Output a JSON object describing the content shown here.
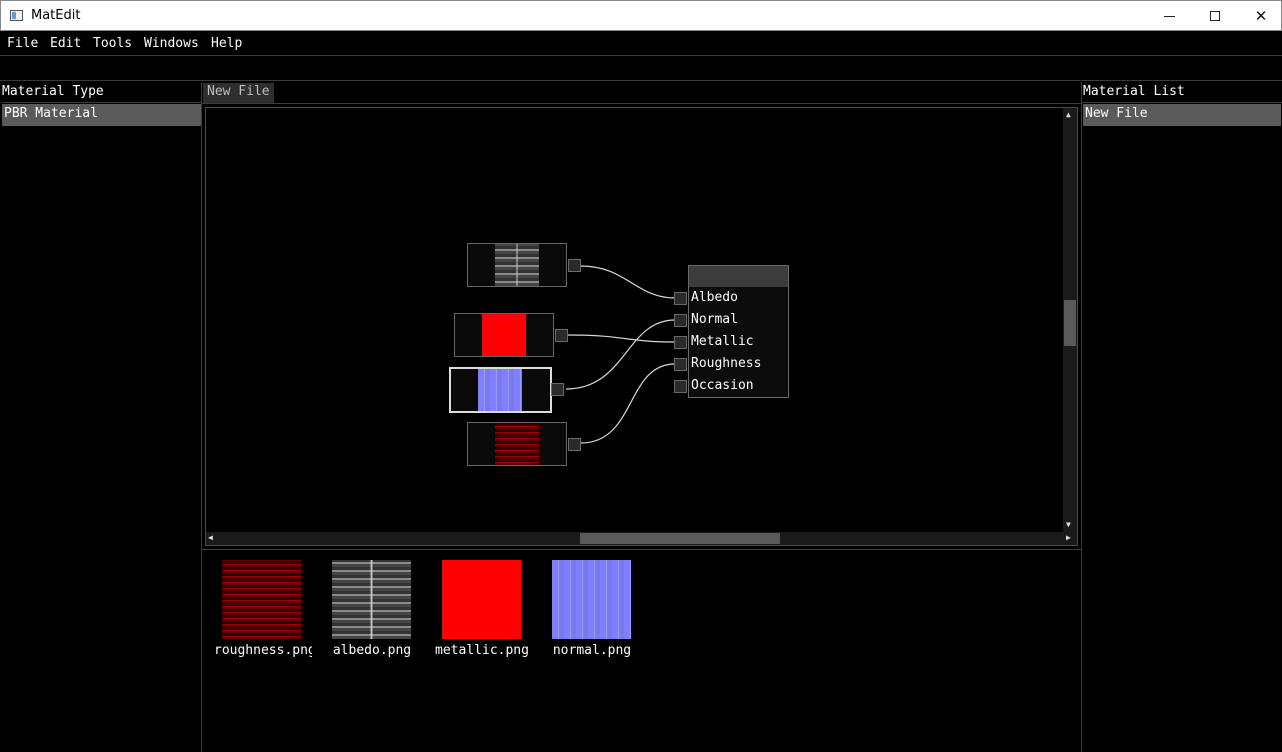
{
  "window": {
    "title": "MatEdit"
  },
  "menu": [
    "File",
    "Edit",
    "Tools",
    "Windows",
    "Help"
  ],
  "left_panel": {
    "header": "Material Type",
    "items": [
      "PBR Material"
    ]
  },
  "right_panel": {
    "header": "Material List",
    "items": [
      "New File"
    ]
  },
  "editor": {
    "tab": "New File",
    "material_node": {
      "inputs": [
        "Albedo",
        "Normal",
        "Metallic",
        "Roughness",
        "Occasion"
      ]
    }
  },
  "assets": [
    "roughness.png",
    "albedo.png",
    "metallic.png",
    "normal.png"
  ],
  "colors": {
    "background": "#000000",
    "selected_row": "#5a5a5a",
    "wire": "#d8d8d8",
    "tab_bg": "#2e2e2e"
  }
}
